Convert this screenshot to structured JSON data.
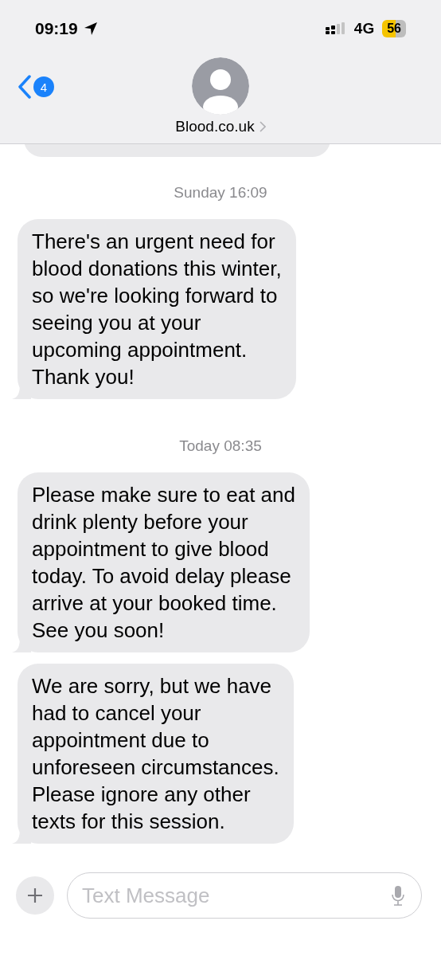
{
  "status_bar": {
    "time": "09:19",
    "network": "4G",
    "battery": "56"
  },
  "header": {
    "back_badge": "4",
    "contact": "Blood.co.uk"
  },
  "conversation": [
    {
      "kind": "timestamp",
      "text": "Sunday 16:09"
    },
    {
      "kind": "message",
      "lines": [
        "There's an urgent need for",
        "blood donations this winter,",
        "so we're looking forward to",
        "seeing you at your",
        "upcoming appointment.",
        "Thank you!"
      ]
    },
    {
      "kind": "timestamp",
      "text": "Today 08:35"
    },
    {
      "kind": "message",
      "lines": [
        "Please make sure to eat and",
        "drink plenty before your",
        "appointment to give blood",
        "today. To avoid delay please",
        "arrive at your booked time.",
        "See you soon!"
      ]
    },
    {
      "kind": "message",
      "lines": [
        "We are sorry, but we have",
        "had to cancel your",
        "appointment due to",
        "unforeseen circumstances.",
        "Please ignore any other",
        "texts for this session."
      ]
    }
  ],
  "composer": {
    "placeholder": "Text Message"
  }
}
